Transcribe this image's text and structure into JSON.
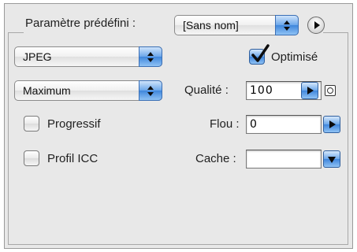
{
  "preset": {
    "label": "Paramètre prédéfini :",
    "value": "[Sans nom]"
  },
  "format": {
    "value": "JPEG"
  },
  "optimise": {
    "label": "Optimisé",
    "checked": true
  },
  "quality_preset": {
    "value": "Maximum"
  },
  "qualite": {
    "label": "Qualité :",
    "value": "100"
  },
  "progressif": {
    "label": "Progressif",
    "checked": false
  },
  "flou": {
    "label": "Flou :",
    "value": "0"
  },
  "profil_icc": {
    "label": "Profil ICC",
    "checked": false
  },
  "cache": {
    "label": "Cache :",
    "value": ""
  }
}
